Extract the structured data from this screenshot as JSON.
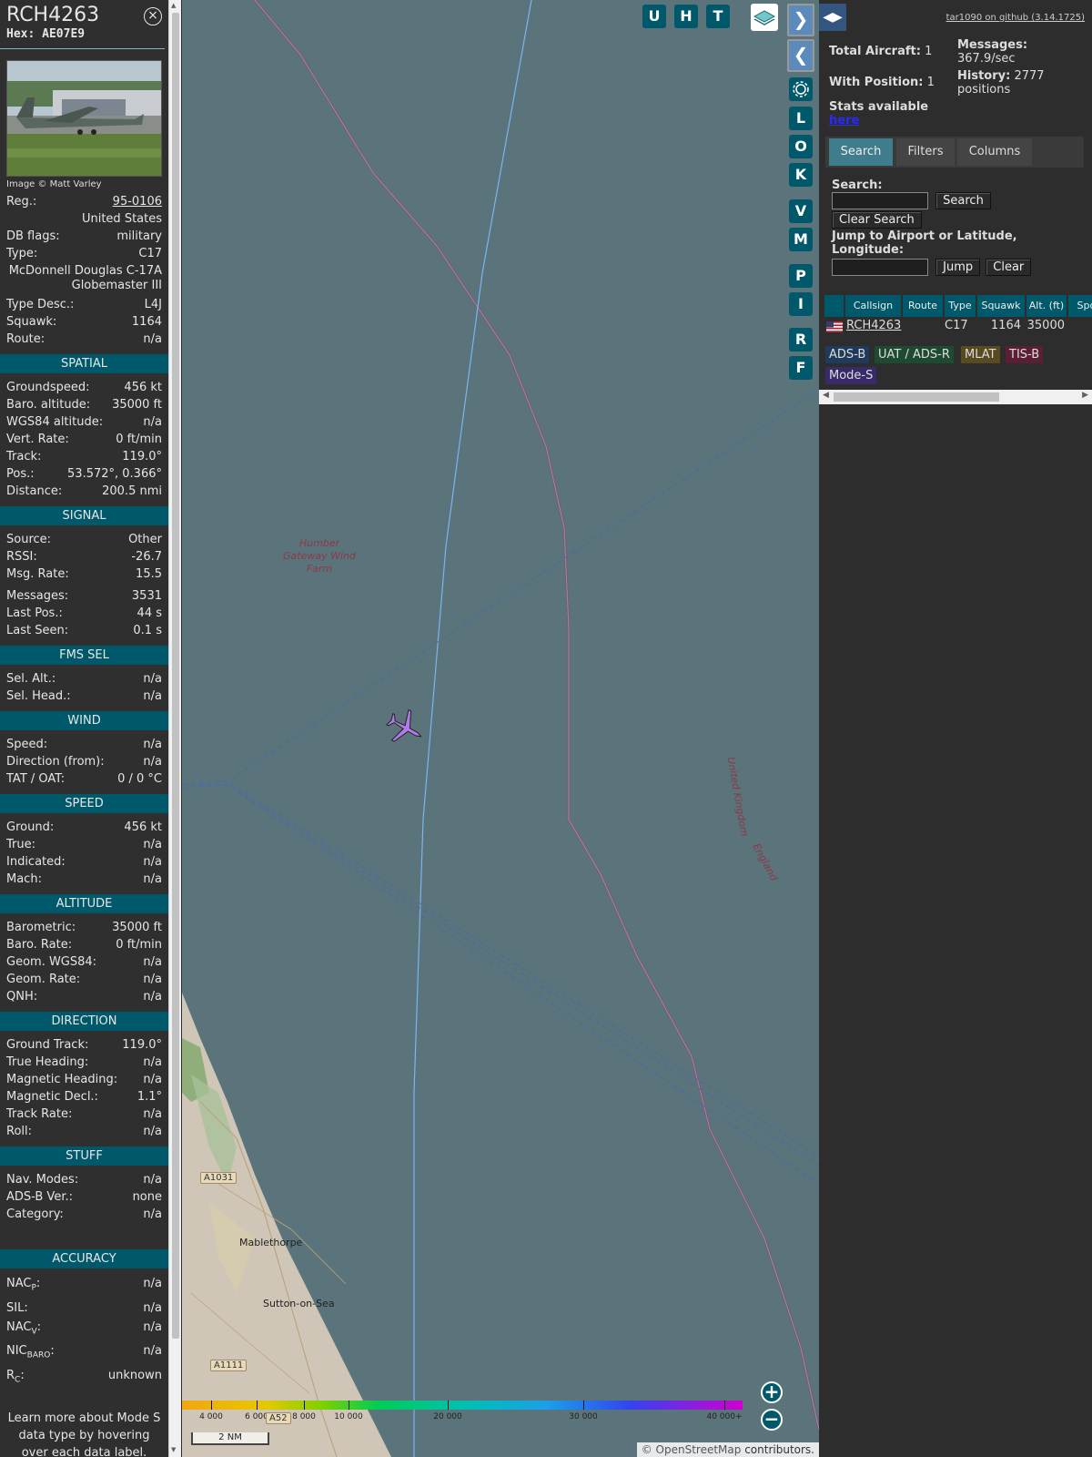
{
  "info": {
    "callsign": "RCH4263",
    "hex": "Hex: AE07E9",
    "close_glyph": "×",
    "photo_credit": "Image © Matt Varley",
    "reg_label": "Reg.:",
    "reg_value": "95-0106",
    "country": "United States",
    "dbflags_label": "DB flags:",
    "dbflags_value": "military",
    "type_label": "Type:",
    "type_value": "C17",
    "type_full": "McDonnell Douglas C-17A Globemaster III",
    "typedesc_label": "Type Desc.:",
    "typedesc_value": "L4J",
    "squawk_label": "Squawk:",
    "squawk_value": "1164",
    "route_label": "Route:",
    "route_value": "n/a",
    "sections": {
      "spatial": "SPATIAL",
      "signal": "SIGNAL",
      "fms": "FMS SEL",
      "wind": "WIND",
      "speed": "SPEED",
      "altitude": "ALTITUDE",
      "direction": "DIRECTION",
      "stuff": "STUFF",
      "accuracy": "ACCURACY"
    },
    "spatial": [
      [
        "Groundspeed:",
        "456 kt"
      ],
      [
        "Baro. altitude:",
        "35000 ft"
      ],
      [
        "WGS84 altitude:",
        "n/a"
      ],
      [
        "Vert. Rate:",
        "0 ft/min"
      ],
      [
        "Track:",
        "119.0°"
      ],
      [
        "Pos.:",
        "53.572°, 0.366°"
      ],
      [
        "Distance:",
        "200.5 nmi"
      ]
    ],
    "signal": [
      [
        "Source:",
        "Other"
      ],
      [
        "RSSI:",
        "-26.7"
      ],
      [
        "Msg. Rate:",
        "15.5"
      ],
      [
        "Messages:",
        "3531"
      ],
      [
        "Last Pos.:",
        "44 s"
      ],
      [
        "Last Seen:",
        "0.1 s"
      ]
    ],
    "fms": [
      [
        "Sel. Alt.:",
        "n/a"
      ],
      [
        "Sel. Head.:",
        "n/a"
      ]
    ],
    "wind": [
      [
        "Speed:",
        "n/a"
      ],
      [
        "Direction (from):",
        "n/a"
      ],
      [
        "TAT / OAT:",
        "0 / 0 °C"
      ]
    ],
    "speed": [
      [
        "Ground:",
        "456 kt"
      ],
      [
        "True:",
        "n/a"
      ],
      [
        "Indicated:",
        "n/a"
      ],
      [
        "Mach:",
        "n/a"
      ]
    ],
    "altitude": [
      [
        "Barometric:",
        "35000 ft"
      ],
      [
        "Baro. Rate:",
        "0 ft/min"
      ],
      [
        "Geom. WGS84:",
        "n/a"
      ],
      [
        "Geom. Rate:",
        "n/a"
      ],
      [
        "QNH:",
        "n/a"
      ]
    ],
    "direction": [
      [
        "Ground Track:",
        "119.0°"
      ],
      [
        "True Heading:",
        "n/a"
      ],
      [
        "Magnetic Heading:",
        "n/a"
      ],
      [
        "Magnetic Decl.:",
        "1.1°"
      ],
      [
        "Track Rate:",
        "n/a"
      ],
      [
        "Roll:",
        "n/a"
      ]
    ],
    "stuff": [
      [
        "Nav. Modes:",
        "n/a"
      ],
      [
        "ADS-B Ver.:",
        "none"
      ],
      [
        "Category:",
        "n/a"
      ]
    ],
    "accuracy": {
      "nacp_main": "NAC",
      "nacp_sub": "P",
      "nacp_value": "n/a",
      "sil_label": "SIL:",
      "sil_value": "n/a",
      "nacv_main": "NAC",
      "nacv_sub": "V",
      "nacv_value": "n/a",
      "nic_main": "NIC",
      "nic_sub": "BARO",
      "nic_value": "n/a",
      "rc_main": "R",
      "rc_sub": "C",
      "rc_value": "unknown"
    },
    "learn_more": "Learn more about Mode S data type by hovering over each data label."
  },
  "map": {
    "labels": {
      "wind_farm": "Humber Gateway Wind Farm",
      "uk": "United Kingdom",
      "england": "England",
      "mablethorpe": "Mablethorpe",
      "sutton": "Sutton-on-Sea",
      "a1031": "A1031",
      "a1111": "A1111",
      "a52": "A52"
    },
    "buttons": [
      "U",
      "H",
      "T"
    ],
    "side_buttons": [
      "L",
      "O",
      "K",
      "V",
      "M",
      "P",
      "I",
      "R",
      "F"
    ],
    "alt_scale": [
      "4 000",
      "6 000",
      "8 000",
      "10 000",
      "20 000",
      "30 000",
      "40 000+"
    ],
    "scale_label": "2 NM",
    "attribution_prefix": "© ",
    "attribution_link": "OpenStreetMap",
    "attribution_suffix": " contributors.",
    "zoom_in": "+",
    "zoom_out": "−",
    "aircraft_color": "#b07ae8"
  },
  "right": {
    "github": "tar1090 on github (3.14.1725)",
    "total_aircraft_label": "Total Aircraft:",
    "total_aircraft_value": "1",
    "with_position_label": "With Position:",
    "with_position_value": "1",
    "messages_label": "Messages:",
    "messages_value": "367.9/sec",
    "history_label": "History:",
    "history_value": "2777 positions",
    "stats_label": "Stats available",
    "stats_link": "here",
    "tabs": [
      "Search",
      "Filters",
      "Columns"
    ],
    "search_label": "Search:",
    "search_button": "Search",
    "clear_search_button": "Clear Search",
    "jump_label": "Jump to Airport or Latitude, Longitude:",
    "jump_button": "Jump",
    "clear_button": "Clear",
    "table_headers": [
      "Callsign",
      "Route",
      "Type",
      "Squawk",
      "Alt. (ft)",
      "Spd"
    ],
    "table_row": {
      "callsign": "RCH4263",
      "route": "",
      "type": "C17",
      "squawk": "1164",
      "altitude": "35000"
    },
    "badges": [
      "ADS-B",
      "UAT / ADS-R",
      "MLAT",
      "TIS-B",
      "Mode-S"
    ],
    "badge_colors": {
      "adsb": "#1f3a5a",
      "uat": "#1e4a32",
      "mlat": "#5a4a22",
      "tisb": "#5a1f34",
      "modes": "#3a2a6a"
    }
  }
}
